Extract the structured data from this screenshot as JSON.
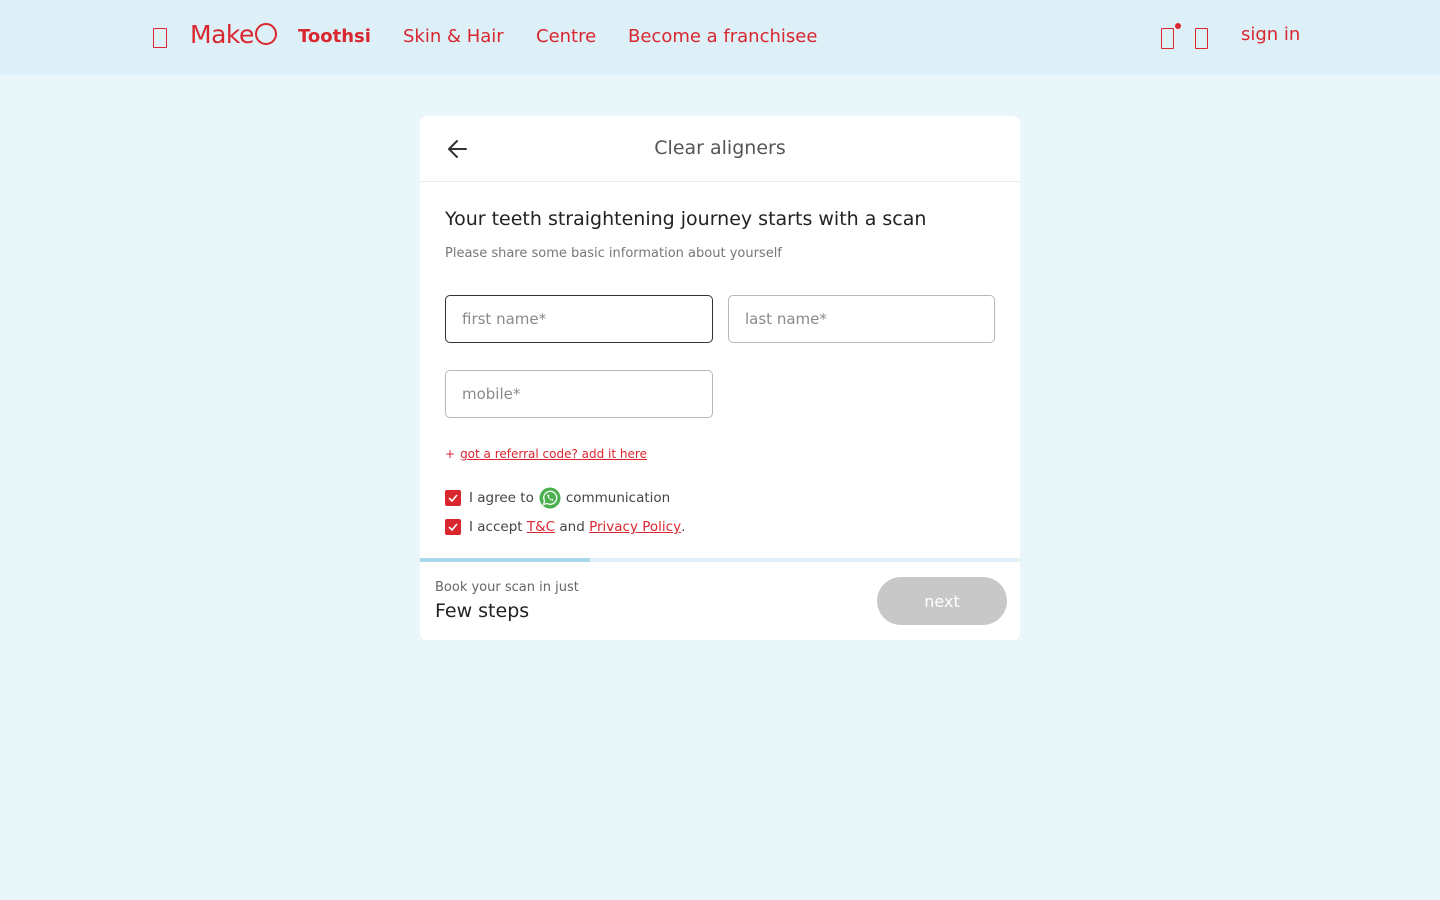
{
  "header": {
    "menu_icon": "menu-icon",
    "logo_text": "Make",
    "nav": [
      {
        "label": "Toothsi",
        "active": true
      },
      {
        "label": "Skin & Hair"
      },
      {
        "label": "Centre"
      },
      {
        "label": "Become a franchisee"
      }
    ],
    "cart_icon": "cart-icon",
    "user_icon": "user-icon",
    "sign_in": "sign in"
  },
  "card": {
    "title": "Clear aligners",
    "heading": "Your teeth straightening journey starts with a scan",
    "subheading": "Please share some basic information about yourself",
    "fields": {
      "first_name": {
        "placeholder": "first name*",
        "value": ""
      },
      "last_name": {
        "placeholder": "last name*",
        "value": ""
      },
      "mobile": {
        "placeholder": "mobile*",
        "value": ""
      }
    },
    "referral_plus": "+",
    "referral_link": "got a referral code? add it here",
    "consent": {
      "whatsapp_prefix": "I agree to",
      "whatsapp_suffix": "communication",
      "whatsapp_checked": true,
      "terms_prefix": "I accept",
      "terms_link": "T&C",
      "terms_and": "and",
      "privacy_link": "Privacy Policy",
      "terms_end": ".",
      "terms_checked": true
    },
    "progress_fraction": 0.283,
    "footer_small": "Book your scan in just",
    "footer_big": "Few steps",
    "next_label": "next"
  },
  "colors": {
    "accent": "#d9262f",
    "background": "#e9f6fa",
    "header_bg": "#ddf0f7",
    "whatsapp": "#4caf50",
    "button_disabled": "#c8c8c8"
  }
}
